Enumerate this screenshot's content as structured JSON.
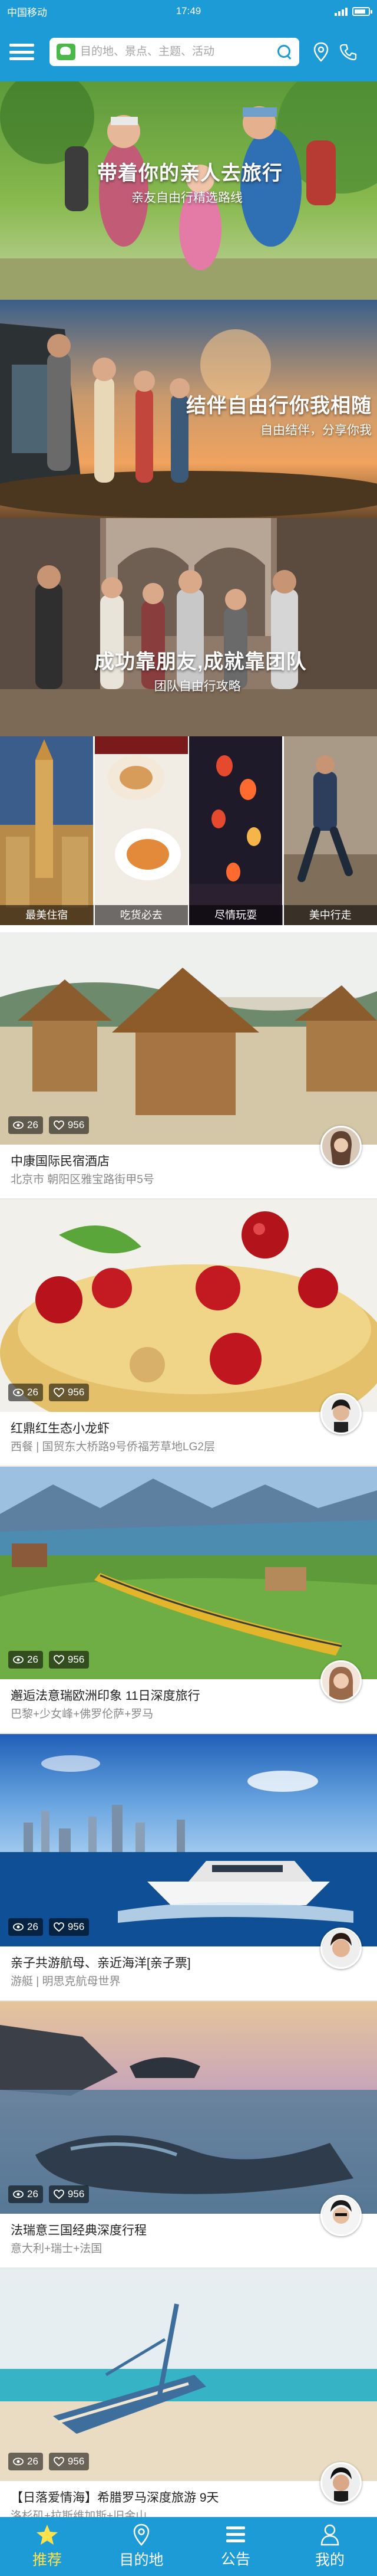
{
  "status_bar": {
    "carrier": "中国移动",
    "time": "17:49"
  },
  "header": {
    "search_placeholder": "目的地、景点、主题、活动"
  },
  "banners": [
    {
      "title": "带着你的亲人去旅行",
      "subtitle": "亲友自由行精选路线"
    },
    {
      "title": "结伴自由行你我相随",
      "subtitle": "自由结伴，分享你我"
    },
    {
      "title": "成功靠朋友,成就靠团队",
      "subtitle": "团队自由行攻略"
    }
  ],
  "tiles": [
    {
      "label": "最美住宿",
      "icon": "building-photo"
    },
    {
      "label": "吃货必去",
      "icon": "food-photo"
    },
    {
      "label": "尽情玩耍",
      "icon": "lantern-photo"
    },
    {
      "label": "美中行走",
      "icon": "hiking-photo"
    }
  ],
  "cards": [
    {
      "views": "26",
      "likes": "956",
      "title": "中康国际民宿酒店",
      "subtitle": "北京市  朝阳区雅宝路街甲5号"
    },
    {
      "views": "26",
      "likes": "956",
      "title": "红鼎红生态小龙虾",
      "subtitle": "西餐 | 国贸东大桥路9号侨福芳草地LG2层"
    },
    {
      "views": "26",
      "likes": "956",
      "title": "邂逅法意瑞欧洲印象 11日深度旅行",
      "subtitle": "巴黎+少女峰+佛罗伦萨+罗马"
    },
    {
      "views": "26",
      "likes": "956",
      "title": "亲子共游航母、亲近海洋[亲子票]",
      "subtitle": "游艇 | 明思克航母世界"
    },
    {
      "views": "26",
      "likes": "956",
      "title": "法瑞意三国经典深度行程",
      "subtitle": "意大利+瑞士+法国"
    },
    {
      "views": "26",
      "likes": "956",
      "title": "【日落爱情海】希腊罗马深度旅游 9天",
      "subtitle": "洛杉矶+拉斯维加斯+旧金山"
    }
  ],
  "tabbar": [
    {
      "label": "推荐",
      "active": true
    },
    {
      "label": "目的地",
      "active": false
    },
    {
      "label": "公告",
      "active": false
    },
    {
      "label": "我的",
      "active": false
    }
  ],
  "colors": {
    "primary": "#1d9bd6",
    "active_tab": "#ffe14a"
  }
}
